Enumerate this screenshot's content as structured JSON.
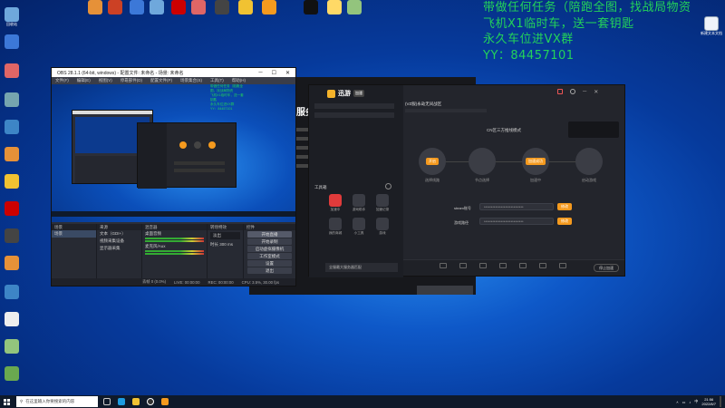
{
  "overlay": {
    "lines": [
      "带做任何任务（陪跑全图，找战局物资",
      "飞机X1临时车，送一套钥匙",
      "永久车位进VX群",
      "YY：84457101"
    ]
  },
  "desktop": {
    "left_icons": [
      "回收站",
      "",
      "",
      "",
      "",
      "",
      "",
      "",
      "",
      "",
      "",
      "",
      "",
      ""
    ],
    "top_icons": [
      "",
      "",
      "",
      "",
      "",
      "",
      "",
      "",
      "",
      "",
      "",
      ""
    ],
    "corner_icon": "新建文本文档"
  },
  "obs": {
    "title": "OBS 28.1.1 (64-bit, windows) - 配置文件: 未命名 - 场景: 未命名",
    "menu": [
      "文件(F)",
      "编辑(E)",
      "视图(V)",
      "停靠部件(D)",
      "配置文件(P)",
      "场景集合(S)",
      "工具(T)",
      "帮助(H)"
    ],
    "docks": {
      "scenes_header": "场景",
      "sources_header": "来源",
      "mixer_header": "混音器",
      "transitions_header": "转场特效",
      "controls_header": "控件",
      "scene_items": [
        "场景"
      ],
      "source_items": [
        "文本（GDI+）",
        "视频采集设备",
        "显示器采集"
      ],
      "mixer_tracks": [
        "桌面音频",
        "麦克风/Aux"
      ],
      "transition_value": "淡出",
      "duration_label": "时长",
      "duration_value": "300 ms",
      "controls": [
        "开始直播",
        "开始录制",
        "启动虚拟摄像机",
        "工作室模式",
        "设置",
        "退出"
      ]
    },
    "status": [
      "丢帧 0 (0.0%)",
      "LIVE: 00:00:00",
      "REC: 00:00:00",
      "CPU: 3.5%, 30.00 fps"
    ]
  },
  "app": {
    "brand": "迅游",
    "version": "加速",
    "subtitle": "(VZ服)永劫无间战区",
    "mode_label": "CN区三方推线模式",
    "steps": [
      {
        "pill": "开启",
        "caption": "选择线路"
      },
      {
        "pill": "",
        "caption": "节点选择"
      },
      {
        "pill": "加速成功",
        "caption": "加速中"
      },
      {
        "pill": "",
        "caption": "启动游戏"
      }
    ],
    "fields": [
      {
        "label": "steam账号",
        "value": "****************************",
        "btn": "修改"
      },
      {
        "label": "游戏路径",
        "value": "****************************",
        "btn": "修改"
      }
    ],
    "tools": [
      "加速中",
      "游戏助手",
      "加速记录",
      "我的商城",
      "小工具",
      "游戏"
    ],
    "bottom_btn": "停止加速",
    "side_header": "工具箱",
    "side_banner": "全服最大服务器匹配",
    "bg_window_text": "服务器匹"
  },
  "taskbar": {
    "search_placeholder": "在这里输入你要搜索的内容",
    "time": "21:56",
    "date": "2022/8/7"
  },
  "colors": {
    "overlay_green": "#23d25a",
    "accent_orange": "#f59a1e"
  }
}
